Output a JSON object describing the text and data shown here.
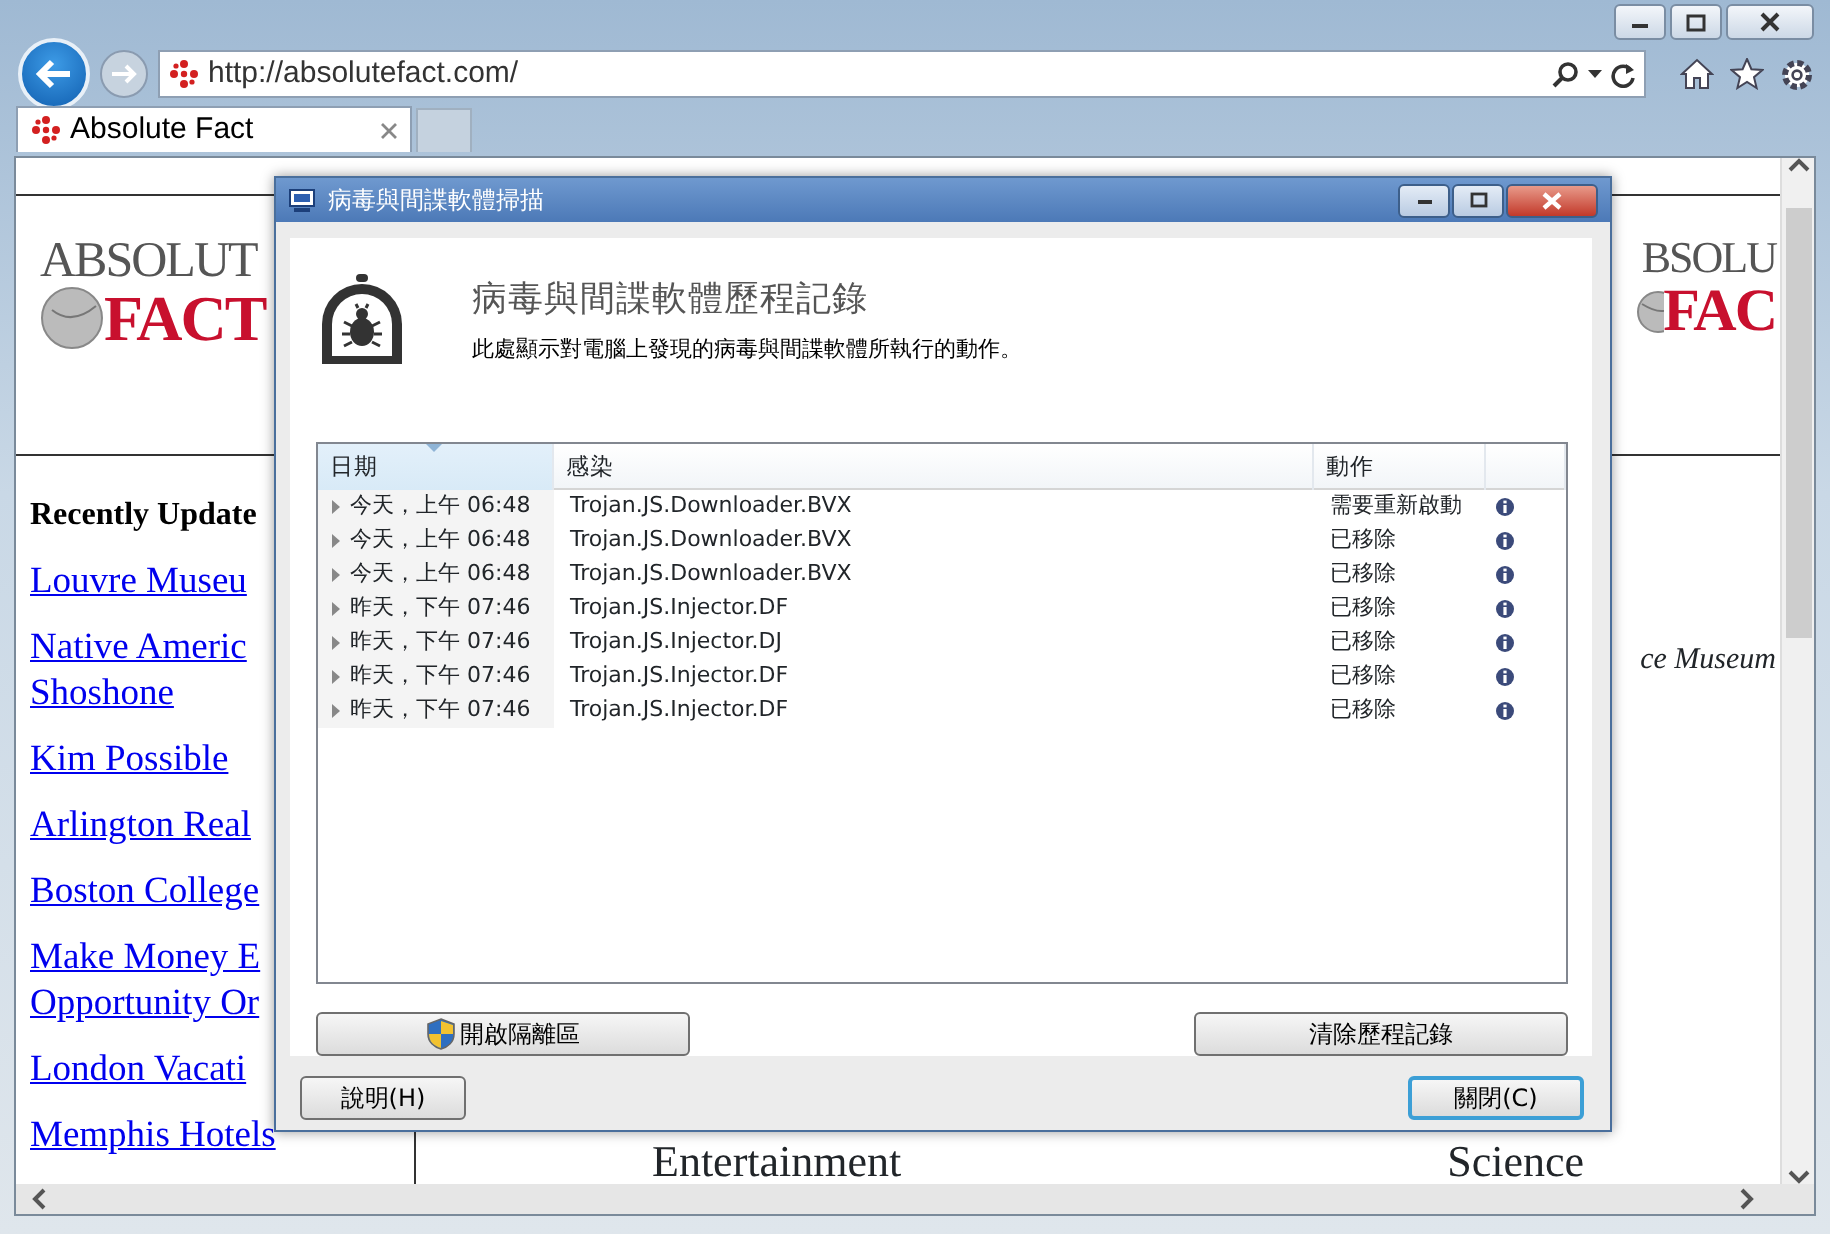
{
  "browser": {
    "address": "http://absolutefact.com/",
    "tabs": [
      {
        "label": "Absolute Fact",
        "selected": true
      }
    ]
  },
  "page": {
    "logos": [
      {
        "line_1": "ABSOLUT",
        "line_2": "FACT"
      },
      {
        "line_1": "BSOLU",
        "line_2": "FAC"
      }
    ],
    "sidebar": {
      "heading": "Recently Update",
      "links": [
        {
          "lines": [
            "Louvre Museu"
          ]
        },
        {
          "lines": [
            "Native Americ",
            "Shoshone"
          ]
        },
        {
          "lines": [
            "Kim Possible"
          ]
        },
        {
          "lines": [
            "Arlington Real"
          ]
        },
        {
          "lines": [
            "Boston College"
          ]
        },
        {
          "lines": [
            "Make Money E",
            "Opportunity Or"
          ]
        },
        {
          "lines": [
            "London Vacati"
          ]
        },
        {
          "lines": [
            "Memphis Hotels"
          ]
        }
      ]
    },
    "caption": "ce Museum",
    "bottom_links": [
      "Entertainment",
      "Science"
    ]
  },
  "dialog": {
    "title": "病毒與間諜軟體掃描",
    "heading": "病毒與間諜軟體歷程記錄",
    "description": "此處顯示對電腦上發現的病毒與間諜軟體所執行的動作。",
    "columns": [
      {
        "label": "日期",
        "sorted": true
      },
      {
        "label": "感染",
        "sorted": false
      },
      {
        "label": "動作",
        "sorted": false
      }
    ],
    "rows": [
      {
        "date": "今天，上午 06:48",
        "infection": "Trojan.JS.Downloader.BVX",
        "action": "需要重新啟動",
        "expanded": false
      },
      {
        "date": "今天，上午 06:48",
        "infection": "Trojan.JS.Downloader.BVX",
        "action": "已移除",
        "expanded": false
      },
      {
        "date": "今天，上午 06:48",
        "infection": "Trojan.JS.Downloader.BVX",
        "action": "已移除",
        "expanded": false
      },
      {
        "date": "昨天，下午 07:46",
        "infection": "Trojan.JS.Injector.DF",
        "action": "已移除",
        "expanded": false
      },
      {
        "date": "昨天，下午 07:46",
        "infection": "Trojan.JS.Injector.DJ",
        "action": "已移除",
        "expanded": false
      },
      {
        "date": "昨天，下午 07:46",
        "infection": "Trojan.JS.Injector.DF",
        "action": "已移除",
        "expanded": false
      },
      {
        "date": "昨天，下午 07:46",
        "infection": "Trojan.JS.Injector.DF",
        "action": "已移除",
        "expanded": false
      }
    ],
    "quarantine_button": "開啟隔離區",
    "clear_button": "清除歷程記錄",
    "help_button": "說明(H)",
    "close_button": "關閉(C)"
  }
}
